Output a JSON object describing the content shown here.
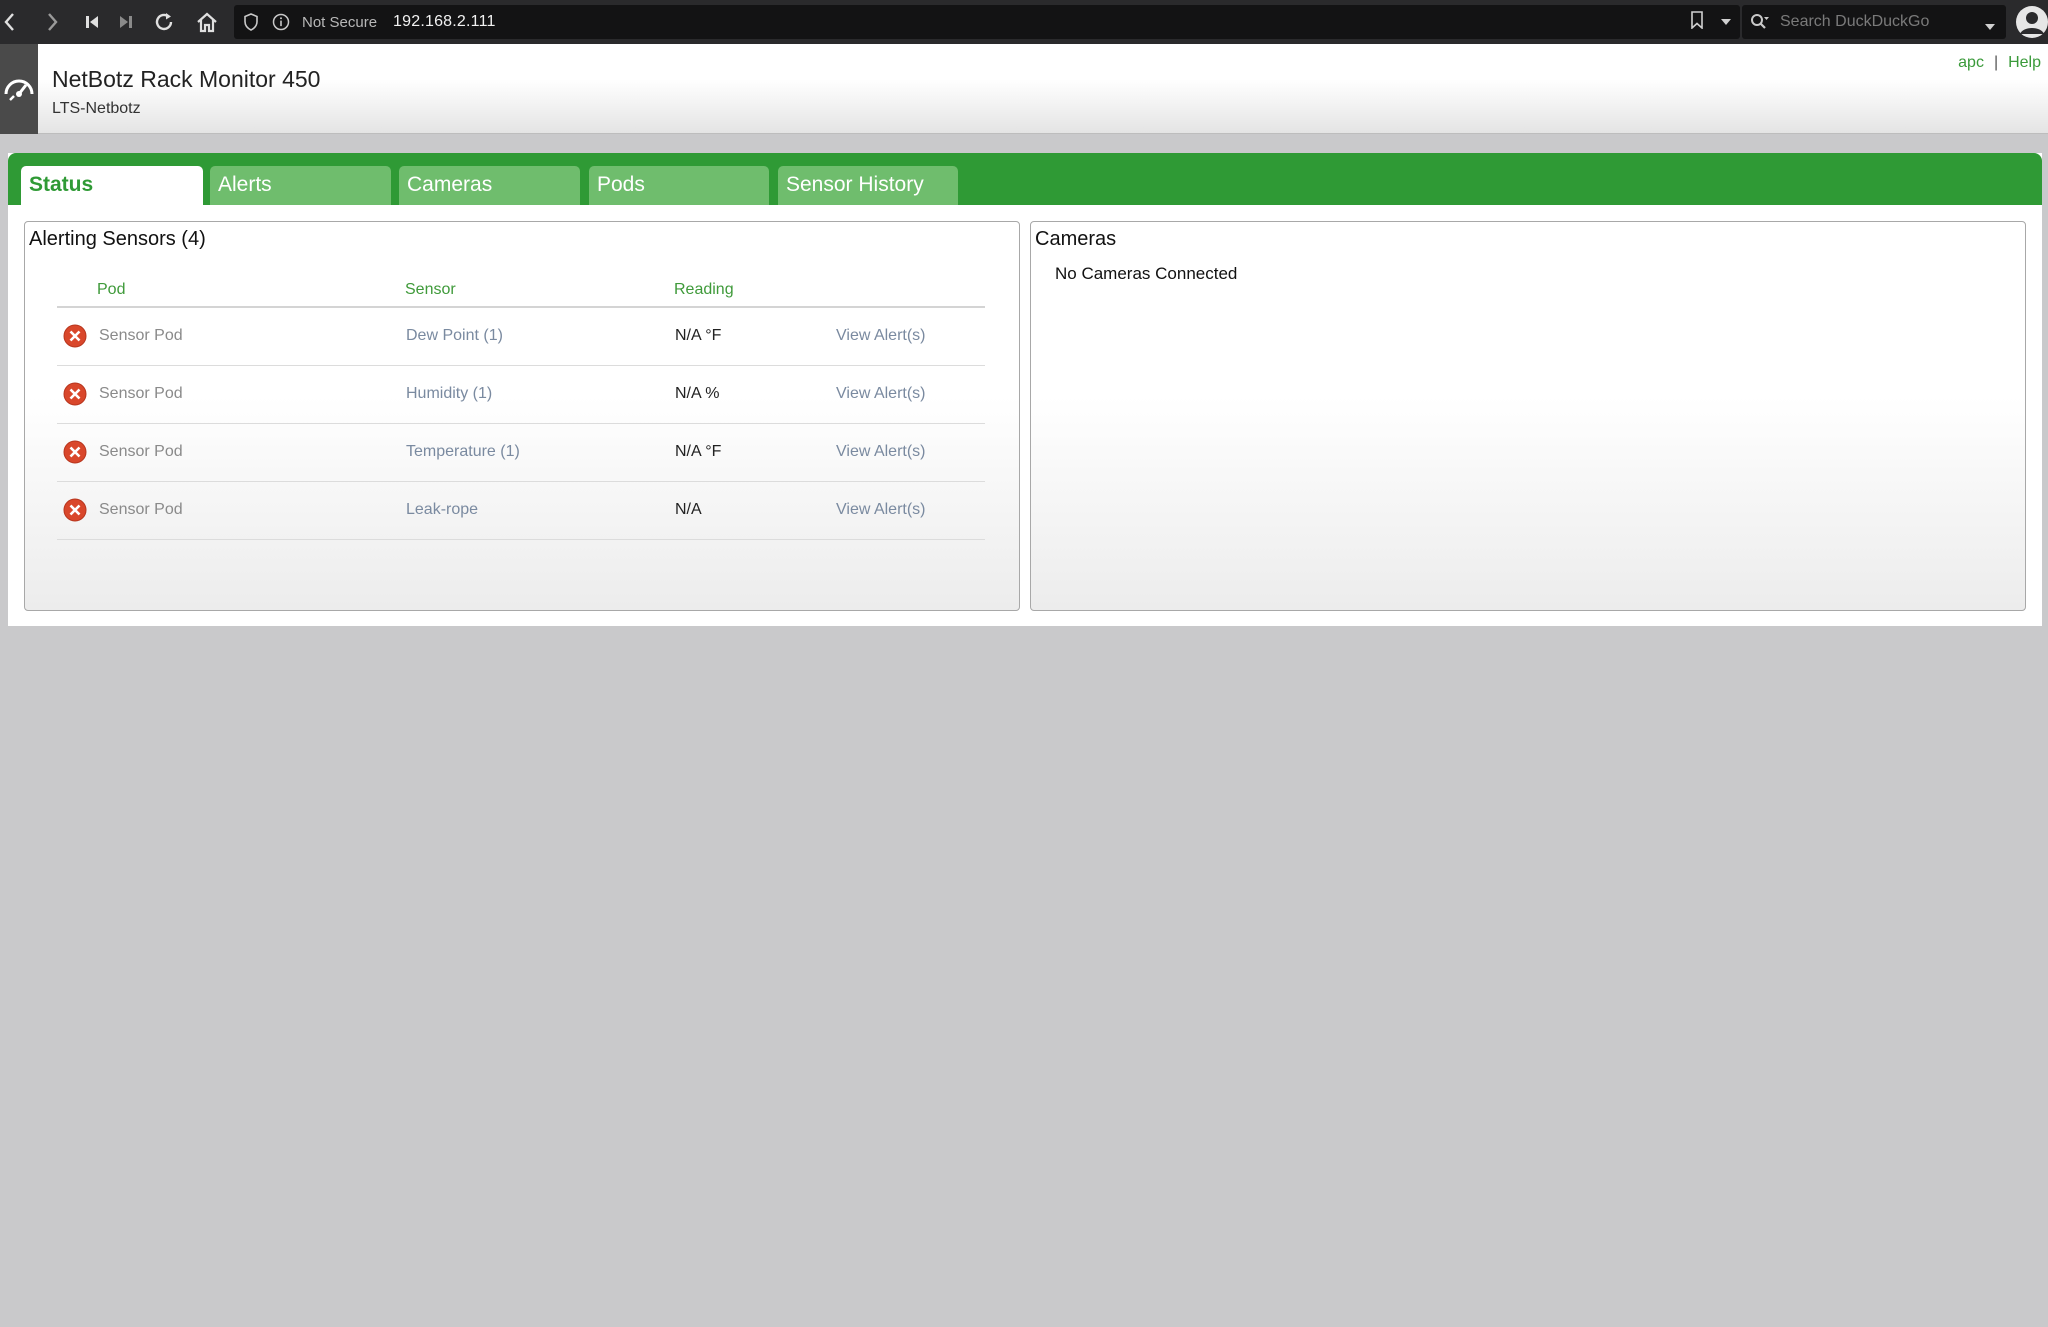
{
  "browser": {
    "security_label": "Not Secure",
    "url": "192.168.2.111",
    "search_placeholder": "Search DuckDuckGo"
  },
  "header": {
    "title": "NetBotz Rack Monitor 450",
    "subtitle": "LTS-Netbotz",
    "user_link": "apc",
    "separator": "|",
    "help_link": "Help"
  },
  "tabs": [
    {
      "label": "Status",
      "active": true
    },
    {
      "label": "Alerts",
      "active": false
    },
    {
      "label": "Cameras",
      "active": false
    },
    {
      "label": "Pods",
      "active": false
    },
    {
      "label": "Sensor History",
      "active": false
    }
  ],
  "alerting": {
    "title": "Alerting Sensors (4)",
    "columns": [
      "Pod",
      "Sensor",
      "Reading"
    ],
    "rows": [
      {
        "status": "error",
        "pod": "Sensor Pod",
        "sensor": "Dew Point (1)",
        "reading": "N/A °F",
        "action": "View Alert(s)"
      },
      {
        "status": "error",
        "pod": "Sensor Pod",
        "sensor": "Humidity (1)",
        "reading": "N/A %",
        "action": "View Alert(s)"
      },
      {
        "status": "error",
        "pod": "Sensor Pod",
        "sensor": "Temperature (1)",
        "reading": "N/A °F",
        "action": "View Alert(s)"
      },
      {
        "status": "error",
        "pod": "Sensor Pod",
        "sensor": "Leak-rope",
        "reading": "N/A",
        "action": "View Alert(s)"
      }
    ]
  },
  "cameras": {
    "title": "Cameras",
    "message": "No Cameras Connected"
  },
  "colors": {
    "brand_green": "#2f9a35",
    "tab_inactive": "#6fbd6d",
    "error_red": "#d9472b",
    "link_blue": "#7a8aa0"
  },
  "icons": {
    "logo": "gauge-icon",
    "row_status": "error-x-circle-icon"
  }
}
